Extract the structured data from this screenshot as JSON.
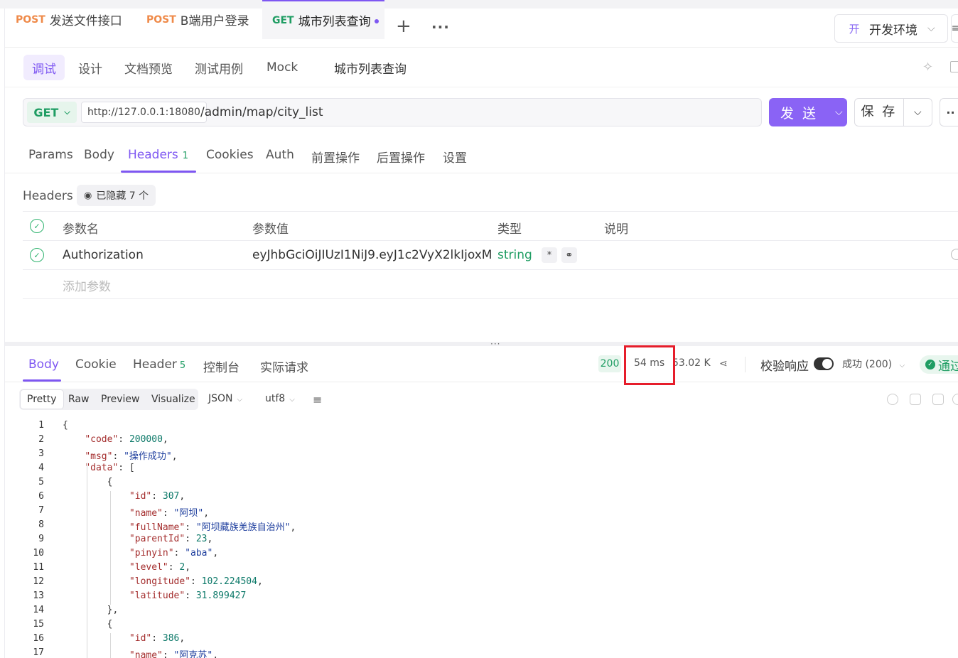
{
  "tabs": [
    {
      "method": "POST",
      "name": "发送文件接口"
    },
    {
      "method": "POST",
      "name": "B端用户登录"
    },
    {
      "method": "GET",
      "name": "城市列表查询",
      "active": true
    }
  ],
  "env": {
    "badge": "开",
    "name": "开发环境"
  },
  "subnav": {
    "items": [
      "调试",
      "设计",
      "文档预览",
      "测试用例",
      "Mock"
    ],
    "active": "调试",
    "api_name": "城市列表查询"
  },
  "request": {
    "method": "GET",
    "base_url": "http://127.0.0.1:18080",
    "path": "/admin/map/city_list",
    "send_label": "发 送",
    "save_label": "保 存"
  },
  "req_tabs": [
    "Params",
    "Body",
    "Headers",
    "Cookies",
    "Auth",
    "前置操作",
    "后置操作",
    "设置"
  ],
  "req_tab_active": "Headers",
  "req_headers_count": "1",
  "headers_section": {
    "label": "Headers",
    "hidden_text": "已隐藏 7 个",
    "columns": [
      "参数名",
      "参数值",
      "类型",
      "说明"
    ],
    "rows": [
      {
        "name": "Authorization",
        "value": "eyJhbGciOiJIUzI1NiJ9.eyJ1c2VyX2lkIjoxM",
        "type": "string",
        "required": "*",
        "link": "⚭"
      }
    ],
    "add_placeholder": "添加参数"
  },
  "response": {
    "tabs": [
      "Body",
      "Cookie",
      "Header",
      "控制台",
      "实际请求"
    ],
    "active": "Body",
    "header_count": "5",
    "status": "200",
    "time": "54 ms",
    "size": "53.02 K",
    "verify_label": "校验响应",
    "verify_value": "成功 (200)",
    "pass_label": "通过"
  },
  "view": {
    "modes": [
      "Pretty",
      "Raw",
      "Preview",
      "Visualize"
    ],
    "active": "Pretty",
    "format": "JSON",
    "encoding": "utf8"
  },
  "code_lines": [
    "{",
    "    \"code\": 200000,",
    "    \"msg\": \"操作成功\",",
    "    \"data\": [",
    "        {",
    "            \"id\": 307,",
    "            \"name\": \"阿坝\",",
    "            \"fullName\": \"阿坝藏族羌族自治州\",",
    "            \"parentId\": 23,",
    "            \"pinyin\": \"aba\",",
    "            \"level\": 2,",
    "            \"longitude\": 102.224504,",
    "            \"latitude\": 31.899427",
    "        },",
    "        {",
    "            \"id\": 386,",
    "            \"name\": \"阿克苏\","
  ],
  "colors": {
    "accent": "#7e57f2",
    "success": "#1f9d63",
    "post": "#ef8a49",
    "highlight": "#e61d2b"
  }
}
